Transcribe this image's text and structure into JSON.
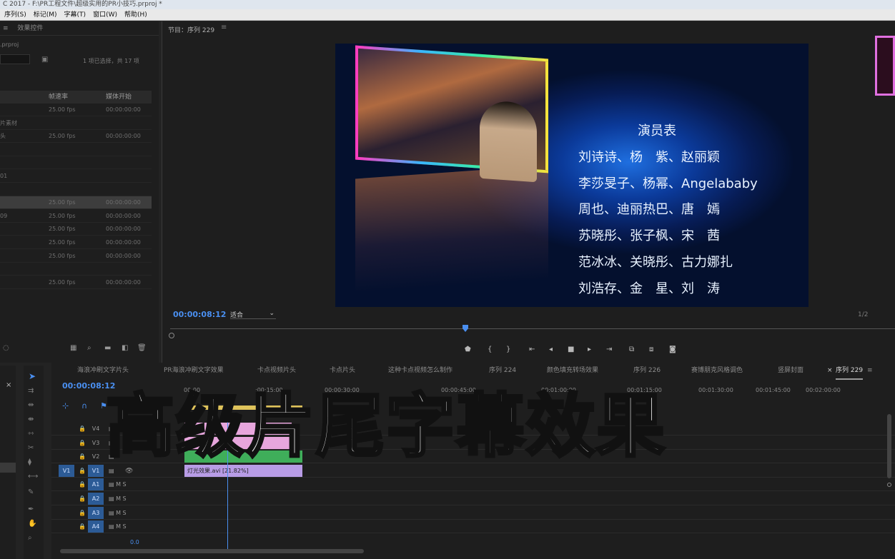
{
  "window": {
    "title": "C 2017 - F:\\PR工程文件\\超级实用的PR小技巧.prproj *"
  },
  "menu": [
    "序列(S)",
    "标记(M)",
    "字幕(T)",
    "窗口(W)",
    "帮助(H)"
  ],
  "project_panel": {
    "tabs": [
      "效果控件"
    ],
    "file": ".prproj",
    "selection": "1 项已选择，共 17 项",
    "columns": [
      "帧速率",
      "媒体开始"
    ],
    "rows": [
      {
        "name": "",
        "fps": "25.00 fps",
        "start": "00:00:00:00",
        "selected": false
      },
      {
        "name": "片素材",
        "fps": "",
        "start": "",
        "selected": false
      },
      {
        "name": "头",
        "fps": "25.00 fps",
        "start": "00:00:00:00",
        "selected": false
      },
      {
        "name": "",
        "fps": "",
        "start": "",
        "selected": false
      },
      {
        "name": "",
        "fps": "",
        "start": "",
        "selected": false
      },
      {
        "name": "01",
        "fps": "",
        "start": "",
        "selected": false
      },
      {
        "name": "",
        "fps": "",
        "start": "",
        "selected": false
      },
      {
        "name": "",
        "fps": "25.00 fps",
        "start": "00:00:00:00",
        "selected": true
      },
      {
        "name": "09",
        "fps": "25.00 fps",
        "start": "00:00:00:00",
        "selected": false
      },
      {
        "name": "",
        "fps": "25.00 fps",
        "start": "00:00:00:00",
        "selected": false
      },
      {
        "name": "",
        "fps": "25.00 fps",
        "start": "00:00:00:00",
        "selected": false
      },
      {
        "name": "",
        "fps": "25.00 fps",
        "start": "00:00:00:00",
        "selected": false
      },
      {
        "name": "",
        "fps": "",
        "start": "",
        "selected": false
      },
      {
        "name": "",
        "fps": "25.00 fps",
        "start": "00:00:00:00",
        "selected": false
      }
    ]
  },
  "program_monitor": {
    "title": "节目：序列 229",
    "timecode": "00:00:08:12",
    "fit": "适合",
    "resolution": "1/2",
    "credits_title": "演员表",
    "credits": [
      "刘诗诗、杨　紫、赵丽颖",
      "李莎旻子、杨幂、Angelababy",
      "周也、迪丽热巴、唐　嫣",
      "苏晓彤、张子枫、宋　茜",
      "范冰冰、关晓彤、古力娜扎",
      "刘浩存、金　星、刘　涛"
    ]
  },
  "timeline": {
    "tabs": [
      "海浪冲刷文字片头",
      "PR海浪冲刷文字效果",
      "卡点视频片头",
      "卡点片头",
      "这种卡点视频怎么制作",
      "序列 224",
      "颜色填充转场效果",
      "序列 226",
      "赛博朋克风格调色",
      "竖屏封面",
      "序列 229"
    ],
    "timecode": "00:00:08:12",
    "ruler": [
      "00:00",
      ":00:15:00",
      "00:00:30:00",
      "00:00:45:00",
      "00:01:00:00",
      "00:01:15:00",
      "00:01:30:00",
      "00:01:45:00",
      "00:02:00:00"
    ],
    "video_tracks": [
      "V4",
      "V3",
      "V2",
      "V1"
    ],
    "audio_tracks": [
      "A1",
      "A2",
      "A3",
      "A4"
    ],
    "clip_v1": "灯光效果.avi [21.82%]",
    "volume": "0.0"
  },
  "overlay": {
    "headline": "高级片尾字幕效果"
  },
  "colors": {
    "accent": "#4a8ff0",
    "clip_purple": "#b89ce6",
    "clip_green": "#3fae5a",
    "clip_pink": "#e7a6dd",
    "frame_pink": "#e070e0"
  }
}
